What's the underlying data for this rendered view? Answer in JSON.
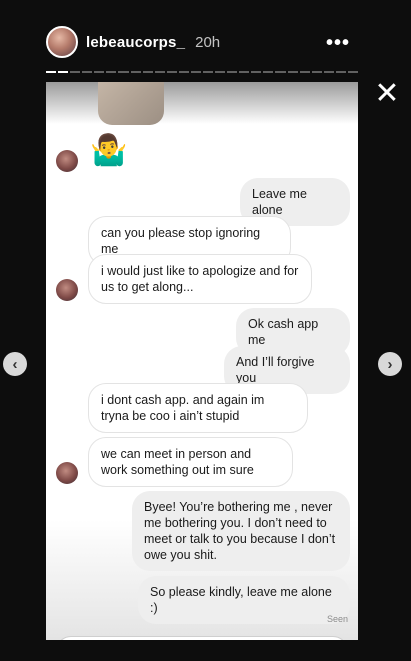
{
  "story": {
    "username": "lebeaucorps_",
    "time": "20h",
    "more_icon": "more-horizontal-icon",
    "close_icon": "close-icon",
    "segments_total": 26,
    "segments_done": 2
  },
  "nav": {
    "prev_glyph": "‹",
    "next_glyph": "›"
  },
  "conversation": {
    "emoji": "🤷‍♂️",
    "messages": [
      {
        "side": "out",
        "text": "Leave me alone"
      },
      {
        "side": "in",
        "text": "can you please stop ignoring me"
      },
      {
        "side": "in",
        "text": "i would just like to apologize and for us to get along..."
      },
      {
        "side": "out",
        "text": "Ok cash app me"
      },
      {
        "side": "out",
        "text": "And I’ll forgive you"
      },
      {
        "side": "in",
        "text": "i dont cash app. and again im tryna be coo i ain’t stupid"
      },
      {
        "side": "in",
        "text": "we can meet in person and work something out im sure"
      },
      {
        "side": "out",
        "text": "Byee! You’re bothering me , never me bothering you. I don’t need to meet or talk to you because I don’t owe you shit."
      },
      {
        "side": "out",
        "text": "So please kindly, leave me alone :)"
      }
    ],
    "seen_label": "Seen"
  }
}
